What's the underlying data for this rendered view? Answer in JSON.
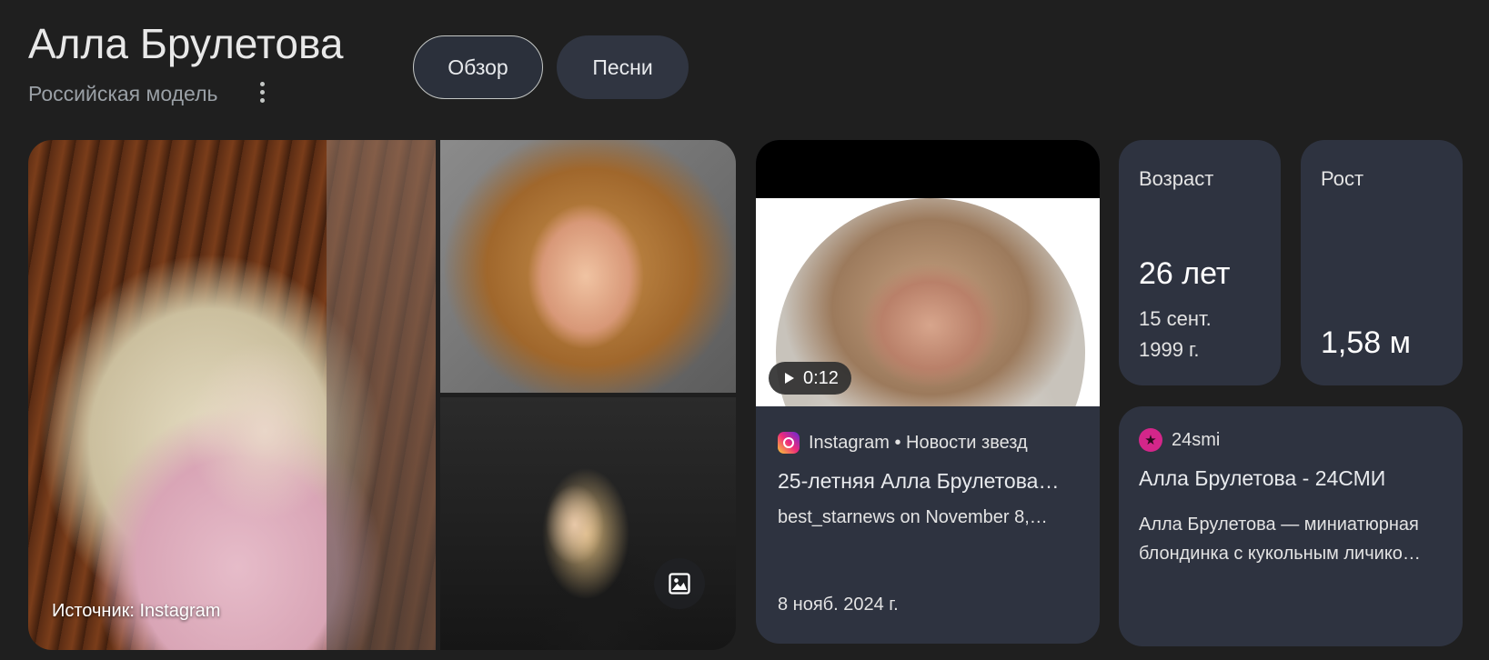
{
  "header": {
    "title": "Алла Брулетова",
    "subtitle": "Российская модель"
  },
  "tabs": [
    {
      "label": "Обзор",
      "selected": true
    },
    {
      "label": "Песни",
      "selected": false
    }
  ],
  "gallery": {
    "source_label": "Источник: Instagram"
  },
  "video_card": {
    "duration": "0:12",
    "source": "Instagram • Новости звезд",
    "title": "25-летняя Алла Брулетова…",
    "description": "best_starnews on November 8,…",
    "date": "8 нояб. 2024 г."
  },
  "facts": {
    "age": {
      "label": "Возраст",
      "value": "26 лет",
      "detail_line1": "15 сент.",
      "detail_line2": "1999 г."
    },
    "height": {
      "label": "Рост",
      "value": "1,58 м"
    }
  },
  "news_card": {
    "source": "24smi",
    "title": "Алла Брулетова - 24СМИ",
    "desc_line1": "Алла Брулетова — миниатюрная",
    "desc_line2": "блондинка с кукольным личико…"
  },
  "icons": {
    "more": "more-vert-icon",
    "image": "image-icon",
    "play": "play-icon",
    "instagram": "instagram-icon",
    "smi": "star-icon"
  }
}
